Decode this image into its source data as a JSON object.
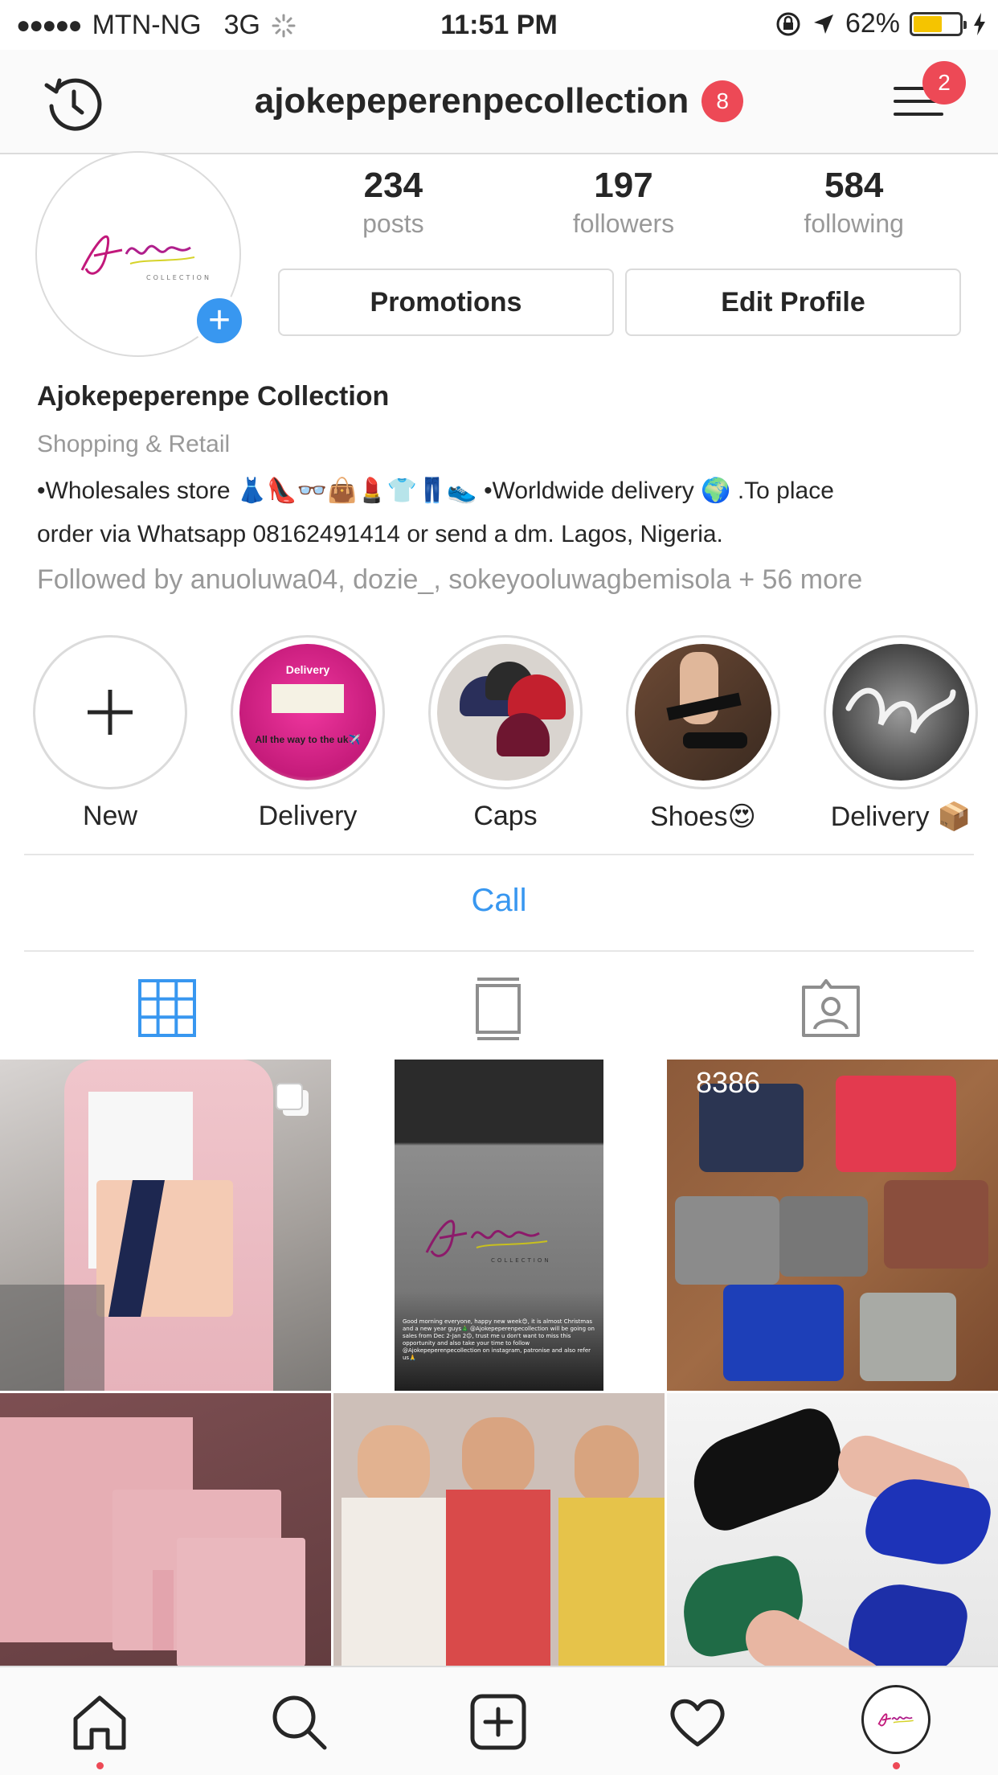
{
  "status_bar": {
    "signal_dots": "●●●●●",
    "carrier": "MTN-NG",
    "network": "3G",
    "time": "11:51 PM",
    "battery_percent": "62%",
    "battery_level": 0.62
  },
  "header": {
    "username": "ajokepeperenpecollection",
    "notification_count": "8",
    "menu_badge_count": "2"
  },
  "profile": {
    "stats": [
      {
        "value": "234",
        "label": "posts"
      },
      {
        "value": "197",
        "label": "followers"
      },
      {
        "value": "584",
        "label": "following"
      }
    ],
    "promotions_label": "Promotions",
    "edit_profile_label": "Edit Profile",
    "display_name": "Ajokepeperenpe Collection",
    "category": "Shopping & Retail",
    "bio_line1": "•Wholesales store 👗👠👓👜💄👕👖👟 •Worldwide delivery 🌍 .To place",
    "bio_line2": "order via Whatsapp 08162491414 or send a dm. Lagos, Nigeria.",
    "followed_by": "Followed by anuoluwa04, dozie_, sokeyooluwagbemisola + 56 more"
  },
  "highlights": [
    {
      "label": "New"
    },
    {
      "label": "Delivery",
      "image_text": "Delivery",
      "image_caption": "All the way to the uk✈️"
    },
    {
      "label": "Caps"
    },
    {
      "label": "Shoes😍"
    },
    {
      "label": "Delivery 📦"
    }
  ],
  "contact": {
    "call_label": "Call"
  },
  "grid": {
    "post3_overlay": "8386",
    "post2_caption": "Good morning everyone, happy new week😊, it is almost Christmas and a new year guys🎄 @Ajokepeperenpecollection will be going on sales from Dec 2-Jan 2😉, trust me u don't want to miss this opportunity and also take your time to follow @Ajokepeperenpecollection on instagram, patronise and also refer us🙏"
  },
  "colors": {
    "accent_blue": "#3897f0",
    "badge_red": "#ed4956",
    "battery_yellow": "#f5c400"
  }
}
